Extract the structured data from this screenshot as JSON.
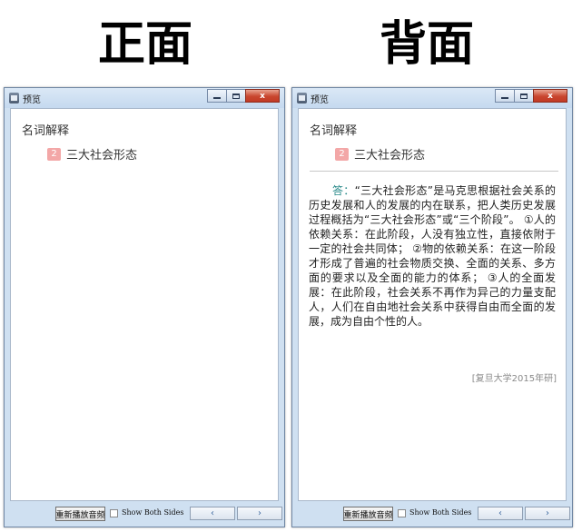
{
  "labels": {
    "front": "正面",
    "back": "背面"
  },
  "window": {
    "title": "预览",
    "minimize": "",
    "maximize": "",
    "close": "x"
  },
  "card": {
    "heading": "名词解释",
    "number": "2",
    "title": "三大社会形态",
    "answer_label": "答：",
    "answer_text": "“三大社会形态”是马克思根据社会关系的历史发展和人的发展的内在联系，把人类历史发展过程概括为“三大社会形态”或“三个阶段”。 ①人的依赖关系：在此阶段，人没有独立性，直接依附于一定的社会共同体； ②物的依赖关系：在这一阶段才形成了普遍的社会物质交换、全面的关系、多方面的要求以及全面的能力的体系； ③人的全面发展：在此阶段，社会关系不再作为异己的力量支配人，人们在自由地社会关系中获得自由而全面的发展，成为自由个性的人。",
    "source": "[复旦大学2015年研]"
  },
  "bottombar": {
    "replay_label": "重新播放音频",
    "show_both_label": "Show Both Sides",
    "prev_icon": "‹",
    "next_icon": "›"
  }
}
